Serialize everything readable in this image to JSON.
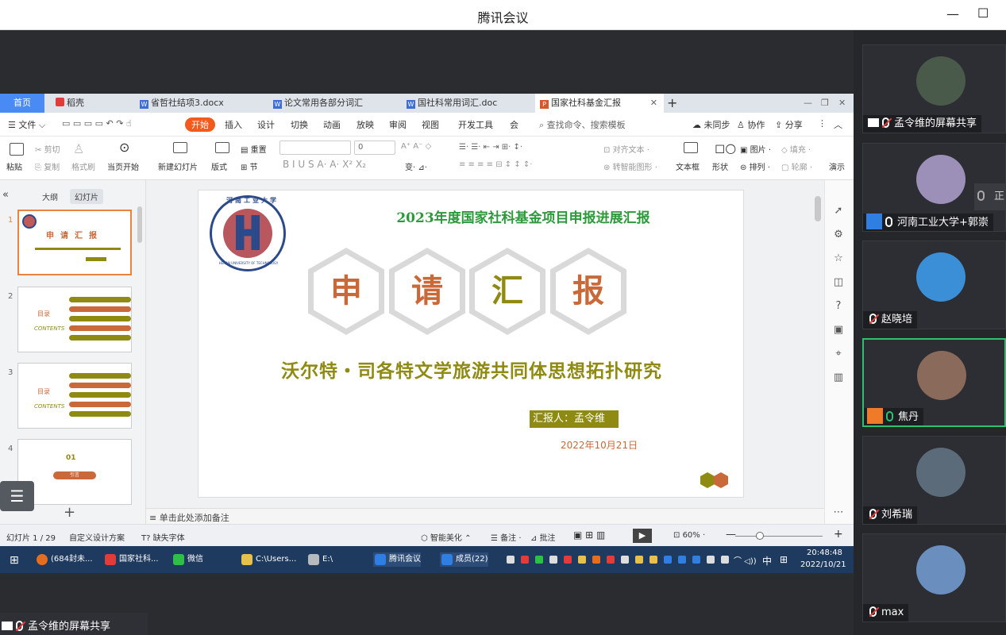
{
  "window": {
    "title": "腾讯会议",
    "minimize": "—",
    "maximize": "☐"
  },
  "tabs": [
    {
      "label": "首页"
    },
    {
      "label": "稻壳"
    },
    {
      "label": "省哲社结项3.docx"
    },
    {
      "label": "论文常用各部分词汇"
    },
    {
      "label": "国社科常用词汇.doc"
    },
    {
      "label": "国家社科基金汇报"
    }
  ],
  "menu": {
    "file": "文件",
    "items": [
      "开始",
      "插入",
      "设计",
      "切换",
      "动画",
      "放映",
      "审阅",
      "视图",
      "开发工具",
      "会"
    ],
    "search": "查找命令、搜索模板",
    "unsync": "未同步",
    "collab": "协作",
    "share": "分享"
  },
  "ribbon": {
    "paste": "粘贴",
    "cut": "剪切",
    "copy": "复制",
    "format": "格式刷",
    "from_current": "当页开始",
    "new_slide": "新建幻灯片",
    "layout": "版式",
    "section": "节",
    "reset": "重置",
    "font_size": "0",
    "align_text": "对齐文本",
    "smart_shape": "转智能图形",
    "textbox": "文本框",
    "shape": "形状",
    "picture": "图片",
    "arrange": "排列",
    "fill": "填充",
    "outline": "轮廓",
    "presenter": "演示"
  },
  "panel": {
    "outline": "大纲",
    "slides": "幻灯片",
    "contents": "CONTENTS",
    "mulu": "目录",
    "section01": "01",
    "section01_label": "引言",
    "thumb_nums": [
      "1",
      "2",
      "3",
      "4"
    ]
  },
  "slide": {
    "title": "2023年度国家社科基金项目申报进展汇报",
    "chars": [
      "申",
      "请",
      "汇",
      "报"
    ],
    "subtitle": "沃尔特・司各特文学旅游共同体思想拓扑研究",
    "reporter": "汇报人：孟令维",
    "date": "2022年10月21日",
    "logo_text": "河南工业大学",
    "logo_en": "HENAN UNIVERSITY OF TECHNOLOGY"
  },
  "notes": "单击此处添加备注",
  "status": {
    "slide_count": "幻灯片 1 / 29",
    "design": "自定义设计方案",
    "missing_font": "缺失字体",
    "smart": "智能美化",
    "notes": "备注",
    "comment": "批注",
    "zoom": "60%"
  },
  "taskbar": {
    "items": [
      "(684封未...",
      "国家社科...",
      "微信",
      "C:\\Users...",
      "E:\\",
      "腾讯会议",
      "成员(22)"
    ],
    "time": "20:48:48",
    "date": "2022/10/21",
    "ime": "中"
  },
  "sharebar": {
    "label": "孟令维的屏幕共享"
  },
  "participants": [
    {
      "label": "孟令维的屏幕共享"
    },
    {
      "label": "河南工业大学+郭崇"
    },
    {
      "label": "赵晓培"
    },
    {
      "label": "焦丹"
    },
    {
      "label": "刘希瑞"
    },
    {
      "label": "max"
    }
  ],
  "speaking": "正"
}
